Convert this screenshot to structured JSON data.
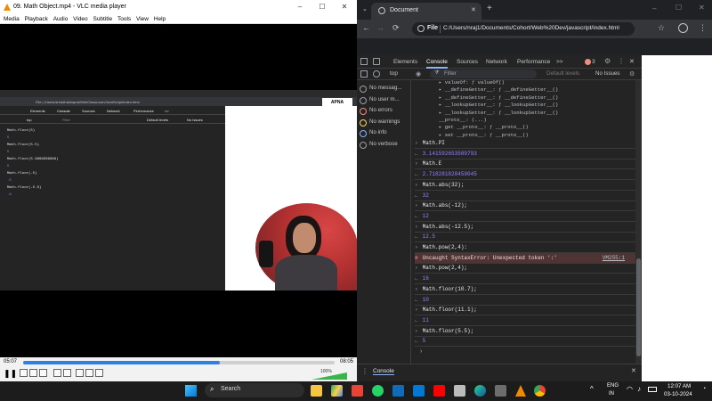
{
  "vlc": {
    "title": "09. Math Object.mp4 - VLC media player",
    "menu": [
      "Media",
      "Playback",
      "Audio",
      "Video",
      "Subtitle",
      "Tools",
      "View",
      "Help"
    ],
    "time_elapsed": "05:07",
    "time_total": "08:05",
    "progress": 0.63,
    "volume": "100%"
  },
  "inner_video": {
    "address": "File | /Users/shradhakhapra/WebClassroom/JavaScript/index.html",
    "devtools_tabs": [
      "Elements",
      "Console",
      "Sources",
      "Network",
      "Performance",
      ">>"
    ],
    "filter_placeholder": "Filter",
    "context": "top",
    "default_levels": "Default levels",
    "no_issues": "No Issues",
    "lines": [
      {
        "kind": "in",
        "text": "Math.floor(5)"
      },
      {
        "kind": "out",
        "text": "5"
      },
      {
        "kind": "in",
        "text": "Math.floor(5.5)"
      },
      {
        "kind": "out",
        "text": "5"
      },
      {
        "kind": "in",
        "text": "Math.floor(5.9999999999)"
      },
      {
        "kind": "out",
        "text": "5"
      },
      {
        "kind": "in",
        "text": "Math.floor(-5)"
      },
      {
        "kind": "out",
        "text": "-5"
      },
      {
        "kind": "in",
        "text": "Math.floor(-5.5)"
      },
      {
        "kind": "out",
        "text": "-6"
      }
    ],
    "logo": "APNA COLLEGE"
  },
  "chrome": {
    "tab_title": "Document",
    "url_scheme": "File",
    "url": "C:/Users/nraj1/Documents/Cohort/Web%20Dev/javascript/index.html",
    "devtools_tabs": [
      "Elements",
      "Console",
      "Sources",
      "Network",
      "Performance",
      ">>"
    ],
    "error_count": "3",
    "context": "top",
    "filter_placeholder": "Filter",
    "default_levels": "Default levels",
    "no_issues": "No Issues",
    "sidebar": [
      {
        "label": "No messag...",
        "icon": "list-icon"
      },
      {
        "label": "No user m...",
        "icon": "user-icon"
      },
      {
        "label": "No errors",
        "icon": "error-icon"
      },
      {
        "label": "No warnings",
        "icon": "warning-icon"
      },
      {
        "label": "No info",
        "icon": "info-icon"
      },
      {
        "label": "No verbose",
        "icon": "gear-icon"
      }
    ],
    "proto_lines": [
      "▸ valueOf: ƒ valueOf()",
      "▸ __defineGetter__: ƒ __defineGetter__()",
      "▸ __defineSetter__: ƒ __defineSetter__()",
      "▸ __lookupGetter__: ƒ __lookupGetter__()",
      "▸ __lookupSetter__: ƒ __lookupSetter__()",
      "  __proto__: (...)",
      "▸ get __proto__: ƒ __proto__()",
      "▸ set __proto__: ƒ __proto__()"
    ],
    "console": [
      {
        "kind": "in",
        "text": "Math.PI"
      },
      {
        "kind": "out",
        "text": "3.141592653589793"
      },
      {
        "kind": "in",
        "text": "Math.E"
      },
      {
        "kind": "out",
        "text": "2.718281828459045"
      },
      {
        "kind": "in",
        "text": "Math.abs(32);"
      },
      {
        "kind": "out",
        "text": "32"
      },
      {
        "kind": "in",
        "text": "Math.abs(-12);"
      },
      {
        "kind": "out",
        "text": "12"
      },
      {
        "kind": "in",
        "text": "Math.abs(-12.5);"
      },
      {
        "kind": "out",
        "text": "12.5"
      },
      {
        "kind": "in",
        "text": "Math.pow(2,4):"
      },
      {
        "kind": "err",
        "text": "Uncaught SyntaxError: Unexpected token ':'",
        "link": "VM255:1"
      },
      {
        "kind": "in",
        "text": "Math.pow(2,4);"
      },
      {
        "kind": "out",
        "text": "16"
      },
      {
        "kind": "in",
        "text": "Math.floor(10.7);"
      },
      {
        "kind": "out",
        "text": "10"
      },
      {
        "kind": "in",
        "text": "Math.floor(11.1);"
      },
      {
        "kind": "out",
        "text": "11"
      },
      {
        "kind": "in",
        "text": "Math.floor(5.5);"
      },
      {
        "kind": "out",
        "text": "5"
      }
    ],
    "drawer_tab": "Console"
  },
  "taskbar": {
    "search_placeholder": "Search",
    "lang_top": "ENG",
    "lang_bottom": "IN",
    "time": "12:07 AM",
    "date": "03-10-2024"
  }
}
